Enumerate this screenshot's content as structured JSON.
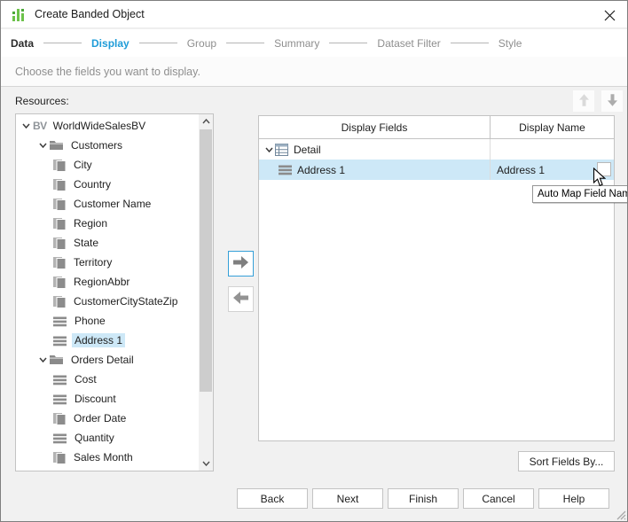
{
  "window": {
    "title": "Create Banded Object"
  },
  "steps": [
    {
      "label": "Data",
      "state": "done"
    },
    {
      "label": "Display",
      "state": "active"
    },
    {
      "label": "Group",
      "state": "pending"
    },
    {
      "label": "Summary",
      "state": "pending"
    },
    {
      "label": "Dataset Filter",
      "state": "pending"
    },
    {
      "label": "Style",
      "state": "pending"
    }
  ],
  "subtitle": "Choose the fields you want to display.",
  "resources": {
    "label": "Resources:",
    "tree": [
      {
        "label": "WorldWideSalesBV",
        "icon": "bv-icon",
        "level": 0,
        "expanded": true
      },
      {
        "label": "Customers",
        "icon": "folder-icon",
        "level": 1,
        "expanded": true
      },
      {
        "label": "City",
        "icon": "dimension-field-icon",
        "level": 2
      },
      {
        "label": "Country",
        "icon": "dimension-field-icon",
        "level": 2
      },
      {
        "label": "Customer Name",
        "icon": "dimension-field-icon",
        "level": 2
      },
      {
        "label": "Region",
        "icon": "dimension-field-icon",
        "level": 2
      },
      {
        "label": "State",
        "icon": "dimension-field-icon",
        "level": 2
      },
      {
        "label": "Territory",
        "icon": "dimension-field-icon",
        "level": 2
      },
      {
        "label": "RegionAbbr",
        "icon": "dimension-field-icon",
        "level": 2
      },
      {
        "label": "CustomerCityStateZip",
        "icon": "dimension-field-icon",
        "level": 2
      },
      {
        "label": "Phone",
        "icon": "detail-field-icon",
        "level": 2
      },
      {
        "label": "Address 1",
        "icon": "detail-field-icon",
        "level": 2,
        "selected": true
      },
      {
        "label": "Orders Detail",
        "icon": "folder-icon",
        "level": 1,
        "expanded": true
      },
      {
        "label": "Cost",
        "icon": "detail-field-icon",
        "level": 2
      },
      {
        "label": "Discount",
        "icon": "detail-field-icon",
        "level": 2
      },
      {
        "label": "Order Date",
        "icon": "dimension-field-icon",
        "level": 2
      },
      {
        "label": "Quantity",
        "icon": "detail-field-icon",
        "level": 2
      },
      {
        "label": "Sales Month",
        "icon": "dimension-field-icon",
        "level": 2
      }
    ]
  },
  "fields_table": {
    "columns": [
      "Display Fields",
      "Display Name"
    ],
    "rows": [
      {
        "field": "Detail",
        "icon": "detail-band-icon",
        "expanded": true,
        "display_name": "",
        "group": true
      },
      {
        "field": "Address 1",
        "icon": "detail-field-icon",
        "display_name": "Address 1",
        "selected": true,
        "has_automap_button": true
      }
    ]
  },
  "tooltip": "Auto Map Field Name",
  "sort_button_label": "Sort Fields By...",
  "footer_buttons": [
    "Back",
    "Next",
    "Finish",
    "Cancel",
    "Help"
  ],
  "colors": {
    "accent_blue": "#1f9cd8",
    "selection_blue": "#cde8f7",
    "focus_border_blue": "#35a0d8",
    "icon_gray": "#8c8c8c"
  }
}
